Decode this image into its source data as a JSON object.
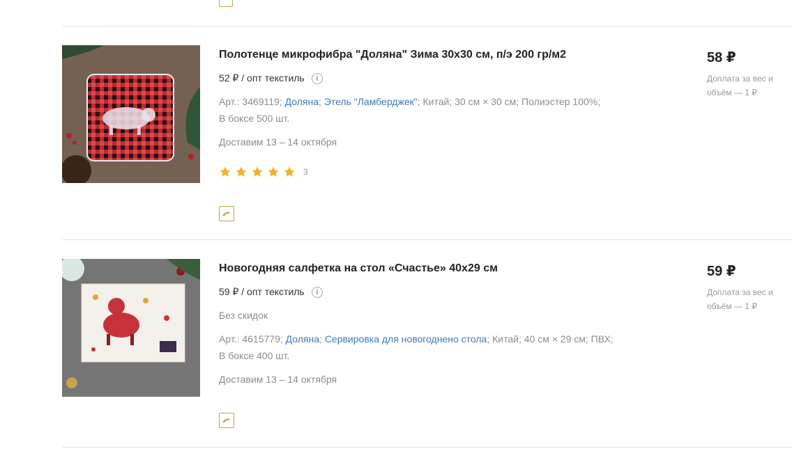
{
  "products": [
    {
      "title": "Полотенце микрофибра \"Доляна\" Зима 30х30 см, п/э 200 гр/м2",
      "price_per_unit": "52 ₽ / опт текстиль",
      "art": "Арт.: 3469119;",
      "brand": "Доляна",
      "collection": "Этель \"Ламберджек\"",
      "country": "Китай;",
      "size": "30 см × 30 см;",
      "material": "Полиэстер 100%;",
      "box": "В боксе 500 шт.",
      "delivery": "Доставим 13 – 14 октября",
      "rating": 5,
      "reviews": "3",
      "price": "58 ₽",
      "surcharge": "Доплата за вес и объём — 1 ₽"
    },
    {
      "title": "Новогодняя салфетка на стол «Счастье» 40х29 см",
      "price_per_unit": "59 ₽ / опт текстиль",
      "discount": "Без скидок",
      "art": "Арт.: 4615779;",
      "brand": "Доляна",
      "collection": "Сервировка для новогоднено стола",
      "country": "Китай;",
      "size": "40 см × 29 см;",
      "material": "ПВХ;",
      "box": "В боксе 400 шт.",
      "delivery": "Доставим 13 – 14 октября",
      "price": "59 ₽",
      "surcharge": "Доплата за вес и объём — 1 ₽"
    }
  ],
  "icons": {
    "info": "info-icon",
    "badge": "dolphin-icon",
    "star": "star-icon"
  },
  "colors": {
    "link": "#3d78c0",
    "star": "#f5b21f",
    "badge_border": "#c9a24a"
  }
}
